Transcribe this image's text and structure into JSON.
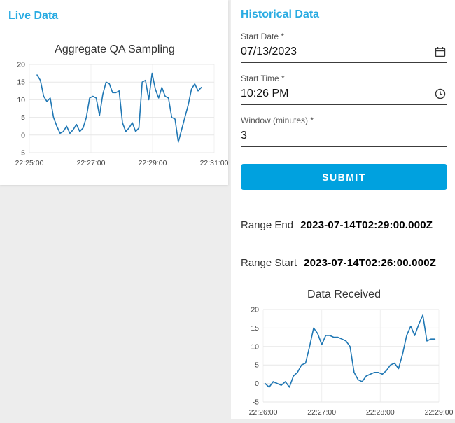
{
  "colors": {
    "accent": "#29abe2",
    "button": "#00a1df",
    "chart_line": "#1f77b4"
  },
  "live": {
    "title": "Live Data"
  },
  "historical": {
    "title": "Historical Data",
    "form": {
      "start_date": {
        "label": "Start Date *",
        "value": "07/13/2023",
        "icon": "calendar-icon"
      },
      "start_time": {
        "label": "Start Time *",
        "value": "10:26 PM",
        "icon": "clock-icon"
      },
      "window": {
        "label": "Window (minutes) *",
        "value": "3"
      },
      "submit_label": "SUBMIT"
    },
    "range_end": {
      "label": "Range End",
      "value": "2023-07-14T02:29:00.000Z"
    },
    "range_start": {
      "label": "Range Start",
      "value": "2023-07-14T02:26:00.000Z"
    }
  },
  "chart_data": [
    {
      "type": "line",
      "title": "Aggregate QA Sampling",
      "ylabel": "",
      "xlabel": "",
      "ylim": [
        -5,
        20
      ],
      "y_ticks": [
        -5,
        0,
        5,
        10,
        15,
        20
      ],
      "xlim_seconds": [
        0,
        360
      ],
      "x_ticks": [
        {
          "pos": 0,
          "label": "22:25:00"
        },
        {
          "pos": 120,
          "label": "22:27:00"
        },
        {
          "pos": 240,
          "label": "22:29:00"
        },
        {
          "pos": 360,
          "label": "22:31:00"
        }
      ],
      "data_x_range_seconds": [
        15,
        335
      ],
      "values": [
        17,
        15.5,
        11,
        9.5,
        10.5,
        5,
        2.5,
        0.5,
        1,
        2.5,
        0.5,
        1.5,
        3,
        1,
        2,
        5,
        10.5,
        11,
        10.5,
        5.5,
        11.5,
        15,
        14.5,
        12,
        12,
        12.5,
        3.5,
        1,
        2,
        3.5,
        1,
        2,
        15,
        15.5,
        10,
        17.5,
        13,
        10.5,
        13.5,
        11,
        10.5,
        5,
        4.5,
        -2,
        1.5,
        5,
        8.5,
        13,
        14.5,
        12.5,
        13.5
      ],
      "line_color": "#1f77b4",
      "grid": true,
      "legend": false
    },
    {
      "type": "line",
      "title": "Data Received",
      "ylabel": "",
      "xlabel": "",
      "ylim": [
        -5,
        20
      ],
      "y_ticks": [
        -5,
        0,
        5,
        10,
        15,
        20
      ],
      "xlim_seconds": [
        0,
        180
      ],
      "x_ticks": [
        {
          "pos": 0,
          "label": "22:26:00"
        },
        {
          "pos": 60,
          "label": "22:27:00"
        },
        {
          "pos": 120,
          "label": "22:28:00"
        },
        {
          "pos": 180,
          "label": "22:29:00"
        }
      ],
      "data_x_range_seconds": [
        2,
        176
      ],
      "values": [
        0,
        -1,
        0.5,
        0,
        -0.5,
        0.5,
        -1,
        2,
        3,
        5,
        5.5,
        10,
        15,
        13.5,
        10.5,
        13,
        13,
        12.5,
        12.5,
        12,
        11.5,
        10,
        3,
        1,
        0.5,
        2,
        2.5,
        3,
        3,
        2.5,
        3.5,
        5,
        5.5,
        4,
        8,
        13,
        15.5,
        13,
        16,
        18.5,
        11.5,
        12,
        12
      ],
      "line_color": "#1f77b4",
      "grid": true,
      "legend": false
    }
  ]
}
